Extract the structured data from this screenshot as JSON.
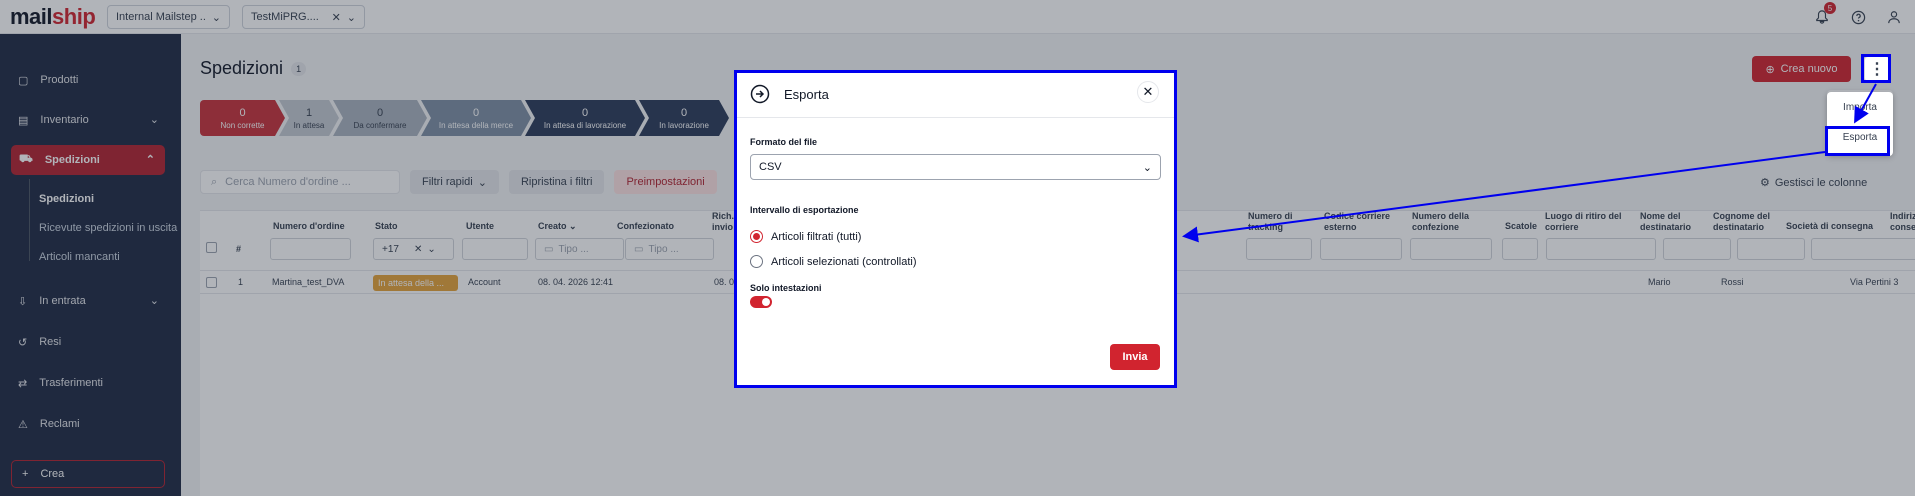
{
  "brand": {
    "logo_main": "mail",
    "logo_accent": "ship"
  },
  "header": {
    "warehouse_select": "Internal Mailstep ...",
    "account_select": "TestMiPRG....",
    "notification_count": "5"
  },
  "sidebar": {
    "items": [
      {
        "label": "Prodotti",
        "icon": "box-icon"
      },
      {
        "label": "Inventario",
        "icon": "clipboard-icon"
      },
      {
        "label": "Spedizioni",
        "icon": "truck-icon"
      },
      {
        "label": "In entrata",
        "icon": "inbox-icon"
      },
      {
        "label": "Resi",
        "icon": "return-icon"
      },
      {
        "label": "Trasferimenti",
        "icon": "transfer-icon"
      },
      {
        "label": "Reclami",
        "icon": "complaint-icon"
      }
    ],
    "subitems": [
      "Spedizioni",
      "Ricevute spedizioni in uscita",
      "Articoli mancanti"
    ],
    "create_label": "Crea"
  },
  "page": {
    "title": "Spedizioni",
    "count": "1",
    "new_button": "Crea nuovo",
    "menu": {
      "import": "Importa",
      "export": "Esporta"
    }
  },
  "steps": [
    {
      "count": "0",
      "label": "Non corrette",
      "color": "#c8323b"
    },
    {
      "count": "1",
      "label": "In attesa",
      "color": "#c4c9d1"
    },
    {
      "count": "0",
      "label": "Da confermare",
      "color": "#aab3bf"
    },
    {
      "count": "0",
      "label": "In attesa della merce",
      "color": "#7e8fa5"
    },
    {
      "count": "0",
      "label": "In attesa di lavorazione",
      "color": "#2c3b5a"
    },
    {
      "count": "0",
      "label": "In lavorazione",
      "color": "#2c3b5a"
    }
  ],
  "toolbar": {
    "search_placeholder": "Cerca Numero d'ordine ...",
    "quick_filters": "Filtri rapidi",
    "reset_filters": "Ripristina i filtri",
    "presets": "Preimpostazioni",
    "manage_columns": "Gestisci le colonne"
  },
  "table": {
    "headers": {
      "hash": "#",
      "order_number": "Numero d'ordine",
      "status": "Stato",
      "user": "Utente",
      "created": "Creato",
      "packed": "Confezionato",
      "req_ship": "Rich. invio",
      "tracking": "Numero di tracking",
      "carrier_code": "Codice corriere esterno",
      "package_number": "Numero della confezione",
      "boxes": "Scatole",
      "pickup_place": "Luogo di ritiro del corriere",
      "recipient_first": "Nome del destinatario",
      "recipient_last": "Cognome del destinatario",
      "delivery_company": "Società di consegna",
      "delivery_address": "Indirizzo di consegna (V"
    },
    "status_filter": "+17",
    "date_placeholder": "Tipo ...",
    "rows": [
      {
        "index": "1",
        "order_number": "Martina_test_DVA",
        "status": "In attesa della ...",
        "user": "Account",
        "created": "08. 04. 2026 12:41",
        "req_ship": "08. 0",
        "first_name": "Mario",
        "last_name": "Rossi",
        "address": "Via Pertini 3"
      }
    ]
  },
  "modal": {
    "title": "Esporta",
    "format_label": "Formato del file",
    "format_value": "CSV",
    "range_label": "Intervallo di esportazione",
    "option_filtered": "Articoli filtrati (tutti)",
    "option_selected": "Articoli selezionati (controllati)",
    "selected_option": "filtered",
    "headers_only_label": "Solo intestazioni",
    "headers_only": true,
    "submit": "Invia"
  },
  "colors": {
    "accent": "#d1242f",
    "sidebar": "#1f2a44",
    "highlight": "#0000ee",
    "warning": "#e5a33a"
  }
}
